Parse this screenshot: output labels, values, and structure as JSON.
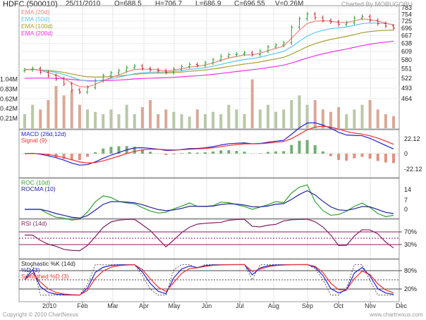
{
  "header": {
    "symbol": "HDFC (500010)",
    "date": "25/11/2010",
    "open": "O=688.5",
    "high": "H=706.7",
    "low": "L=686.9",
    "close": "C=696.55",
    "volume": "V=0.26M",
    "credit": "Charted By MOBUGOBU"
  },
  "footer": {
    "left": "Copyright © 2010 ChartNexus",
    "right": "www.chartnexus.com"
  },
  "colors": {
    "up": "#2ca02c",
    "down": "#c0282a",
    "ema20": "#f08080",
    "ema50": "#5bc8f0",
    "ema100": "#a8a030",
    "ema200": "#f030f0",
    "macd": "#2020d0",
    "signal": "#f03030",
    "roc": "#30a030",
    "rocma": "#2020a0",
    "rsi": "#802060"
  },
  "chart_data": {
    "type": "line",
    "title": "HDFC (500010)",
    "x_ticks": [
      "2010",
      "Feb",
      "Mar",
      "Apr",
      "May",
      "Jun",
      "Jul",
      "Aug",
      "Sep",
      "Oct",
      "Nov",
      "Dec"
    ],
    "price_axis": {
      "ticks": [
        "783",
        "754",
        "725",
        "696",
        "667",
        "638",
        "609",
        "580",
        "551",
        "522",
        "493",
        "464"
      ],
      "scale": "log",
      "range": [
        464,
        783
      ]
    },
    "volume_axis": {
      "ticks": [
        "1.04M",
        "0.83M",
        "0.62M",
        "0.42M",
        "0.21M"
      ]
    },
    "legend": [
      "EMA (20d)",
      "EMA (50d)",
      "EMA (100d)",
      "EMA (200d)"
    ],
    "close": [
      548,
      552,
      540,
      530,
      520,
      505,
      488,
      482,
      495,
      515,
      530,
      538,
      545,
      555,
      560,
      552,
      548,
      545,
      540,
      550,
      558,
      565,
      562,
      570,
      580,
      592,
      598,
      600,
      604,
      598,
      610,
      625,
      632,
      640,
      700,
      735,
      755,
      740,
      728,
      722,
      712,
      718,
      738,
      745,
      728,
      715,
      705,
      696
    ],
    "volume": [
      0.3,
      0.5,
      0.4,
      0.6,
      0.9,
      0.7,
      0.8,
      0.5,
      0.4,
      0.35,
      0.3,
      0.4,
      0.3,
      0.5,
      0.3,
      0.45,
      0.6,
      0.3,
      0.4,
      0.35,
      0.3,
      0.25,
      0.4,
      0.3,
      0.35,
      0.3,
      0.5,
      0.4,
      0.3,
      1.04,
      0.4,
      0.5,
      0.35,
      0.4,
      0.6,
      0.7,
      0.5,
      0.6,
      0.4,
      0.35,
      0.45,
      0.3,
      0.4,
      0.5,
      0.6,
      0.4,
      0.3,
      0.26
    ],
    "panels": [
      {
        "name": "MACD",
        "labels": [
          "MACD (26d,12d)",
          "Signal (9)"
        ],
        "ticks": [
          "22.12",
          "0",
          "-22.12"
        ]
      },
      {
        "name": "ROC",
        "labels": [
          "ROC (10d)",
          "ROCMA (10)"
        ],
        "ticks": [
          "14",
          "7",
          "0"
        ]
      },
      {
        "name": "RSI",
        "labels": [
          "RSI (14d)"
        ],
        "ticks": [
          "70%",
          "30%"
        ]
      },
      {
        "name": "Stochastic",
        "labels": [
          "Stochastic %K (14d)",
          "%D (3)",
          "Smoothed %D (3)"
        ],
        "ticks": [
          "80%",
          "20%"
        ]
      }
    ]
  }
}
